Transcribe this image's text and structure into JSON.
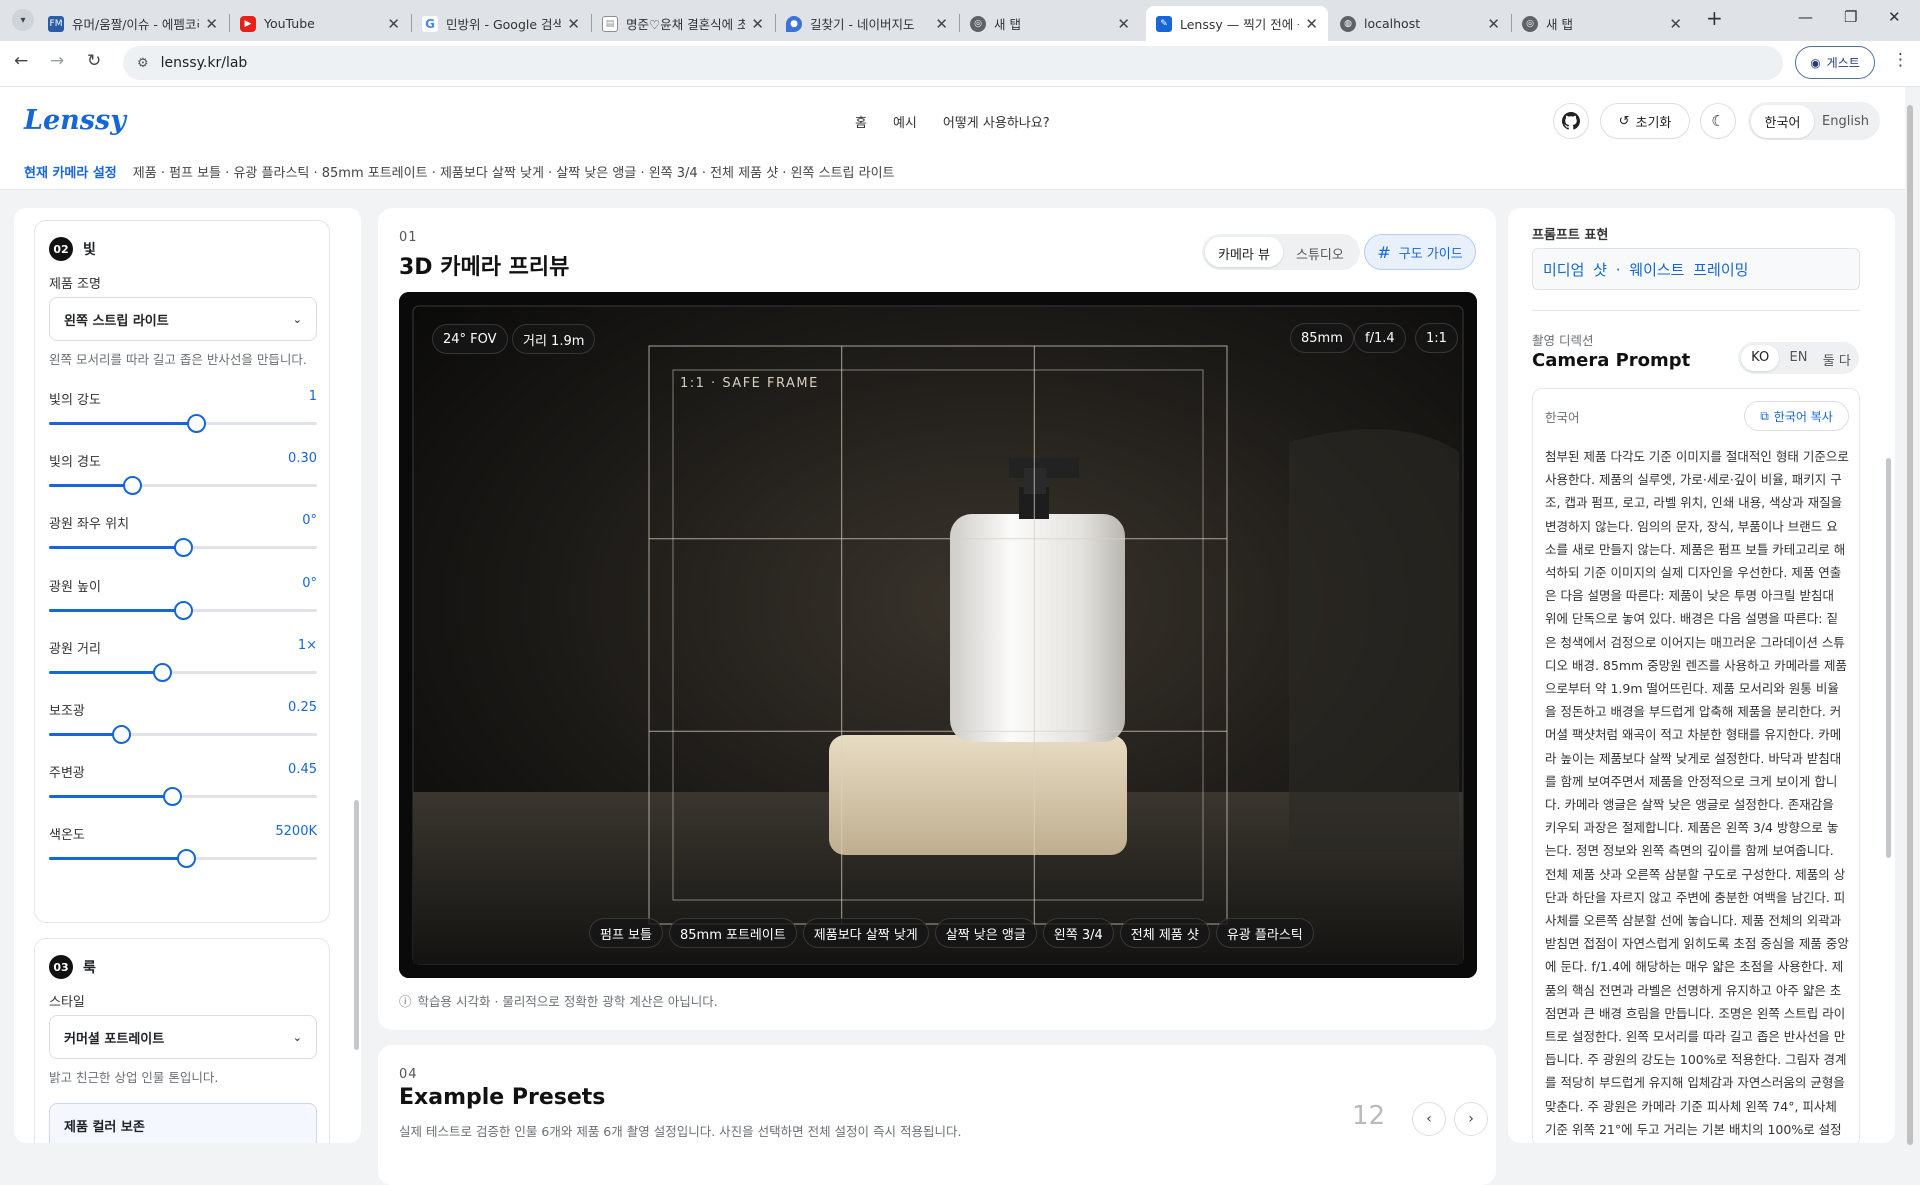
{
  "browser": {
    "tabs": [
      {
        "title": "유머/움짤/이슈 - 에펨코리아",
        "icon": "fmkorea-favicon",
        "color": "#2b5aa7"
      },
      {
        "title": "YouTube",
        "icon": "youtube-favicon",
        "color": "#e62117"
      },
      {
        "title": "민방위 - Google 검색",
        "icon": "google-favicon",
        "color": "#4285f4"
      },
      {
        "title": "명준♡윤채 결혼식에 초대합니다",
        "icon": "document-favicon",
        "color": "#8a8f96"
      },
      {
        "title": "길찾기 - 네이버지도",
        "icon": "map-pin-favicon",
        "color": "#3b73d6"
      },
      {
        "title": "새 탭",
        "icon": "chrome-favicon",
        "color": "#5f6368"
      },
      {
        "title": "Lenssy — 찍기 전에 구도를",
        "icon": "lenssy-favicon",
        "color": "#1566d6"
      },
      {
        "title": "localhost",
        "icon": "globe-favicon",
        "color": "#5f6368"
      },
      {
        "title": "새 탭",
        "icon": "chrome-favicon",
        "color": "#5f6368"
      }
    ],
    "url": "lenssy.kr/lab",
    "guest_label": "게스트"
  },
  "app": {
    "logo": "Lenssy",
    "nav": [
      "홈",
      "예시",
      "어떻게 사용하나요?"
    ],
    "reset_label": "초기화",
    "lang": [
      "한국어",
      "English"
    ]
  },
  "breadcrumb": {
    "label": "현재 카메라 설정",
    "value": "제품 · 펌프 보틀 · 유광 플라스틱 · 85mm 포트레이트 · 제품보다 살짝 낮게 · 살짝 낮은 앵글 · 왼쪽 3/4 · 전체 제품 샷 · 왼쪽 스트립 라이트"
  },
  "light_section": {
    "num": "02",
    "title": "빛",
    "lighting_label": "제품 조명",
    "lighting_value": "왼쪽 스트립 라이트",
    "lighting_hint": "왼쪽 모서리를 따라 길고 좁은 반사선을 만듭니다.",
    "sliders": [
      {
        "label": "빛의 강도",
        "value": "1",
        "level": 0.55
      },
      {
        "label": "빛의 경도",
        "value": "0.30",
        "level": 0.31
      },
      {
        "label": "광원 좌우 위치",
        "value": "0°",
        "level": 0.5
      },
      {
        "label": "광원 높이",
        "value": "0°",
        "level": 0.5
      },
      {
        "label": "광원 거리",
        "value": "1×",
        "level": 0.42
      },
      {
        "label": "보조광",
        "value": "0.25",
        "level": 0.27
      },
      {
        "label": "주변광",
        "value": "0.45",
        "level": 0.46
      },
      {
        "label": "색온도",
        "value": "5200K",
        "level": 0.51
      }
    ]
  },
  "look_section": {
    "num": "03",
    "title": "룩",
    "style_label": "스타일",
    "style_value": "커머셜 포트레이트",
    "style_hint": "밝고 친근한 상업 인물 톤입니다.",
    "color_label": "제품 컬러 보존"
  },
  "preview": {
    "step": "01",
    "title": "3D 카메라 프리뷰",
    "view_tabs": [
      "카메라 뷰",
      "스튜디오"
    ],
    "guide_label": "구도 가이드",
    "fov_chip": "24° FOV",
    "distance_chip": "거리 1.9m",
    "lens_chip": "85mm",
    "aperture_chip": "f/1.4",
    "ratio_chip": "1:1",
    "safe_frame_label": "1:1 · SAFE FRAME",
    "tags": [
      "펌프 보틀",
      "85mm 포트레이트",
      "제품보다 살짝 낮게",
      "살짝 낮은 앵글",
      "왼쪽 3/4",
      "전체 제품 샷",
      "유광 플라스틱"
    ],
    "footnote": "학습용 시각화 · 물리적으로 정확한 광학 계산은 아닙니다."
  },
  "presets": {
    "step": "04",
    "title": "Example Presets",
    "subtitle": "실제 테스트로 검증한 인물 6개와 제품 6개 촬영 설정입니다. 사진을 선택하면 전체 설정이 즉시 적용됩니다.",
    "count": "12"
  },
  "prompt_panel": {
    "expr_label": "프롬프트 표현",
    "expr_value": "미디엄 샷 · 웨이스트 프레이밍",
    "direction_label": "촬영 디렉션",
    "title": "Camera Prompt",
    "lang_tabs": [
      "KO",
      "EN",
      "둘 다"
    ],
    "box_label": "한국어",
    "copy_label": "한국어 복사",
    "text": "첨부된 제품 다각도 기준 이미지를 절대적인 형태 기준으로 사용한다. 제품의 실루엣, 가로·세로·깊이 비율, 패키지 구조, 캡과 펌프, 로고, 라벨 위치, 인쇄 내용, 색상과 재질을 변경하지 않는다. 임의의 문자, 장식, 부품이나 브랜드 요소를 새로 만들지 않는다. 제품은 펌프 보틀 카테고리로 해석하되 기준 이미지의 실제 디자인을 우선한다. 제품 연출은 다음 설명을 따른다: 제품이 낮은 투명 아크릴 받침대 위에 단독으로 놓여 있다. 배경은 다음 설명을 따른다: 짙은 청색에서 검정으로 이어지는 매끄러운 그라데이션 스튜디오 배경. 85mm 중망원 렌즈를 사용하고 카메라를 제품으로부터 약 1.9m 떨어뜨린다. 제품 모서리와 원통 비율을 정돈하고 배경을 부드럽게 압축해 제품을 분리한다. 커머셜 팩샷처럼 왜곡이 적고 차분한 형태를 유지한다. 카메라 높이는 제품보다 살짝 낮게로 설정한다. 바닥과 받침대를 함께 보여주면서 제품을 안정적으로 크게 보이게 합니다. 카메라 앵글은 살짝 낮은 앵글로 설정한다. 존재감을 키우되 과장은 절제합니다. 제품은 왼쪽 3/4 방향으로 놓는다. 정면 정보와 왼쪽 측면의 깊이를 함께 보여줍니다. 전체 제품 샷과 오른쪽 삼분할 구도로 구성한다. 제품의 상단과 하단을 자르지 않고 주변에 충분한 여백을 남긴다. 피사체를 오른쪽 삼분할 선에 놓습니다. 제품 전체의 외곽과 받침면 접점이 자연스럽게 읽히도록 초점 중심을 제품 중앙에 둔다. f/1.4에 해당하는 매우 얇은 초점을 사용한다. 제품의 핵심 전면과 라벨은 선명하게 유지하고 아주 얇은 초점면과 큰 배경 흐림을 만듭니다. 조명은 왼쪽 스트립 라이트로 설정한다. 왼쪽 모서리를 따라 길고 좁은 반사선을 만듭니다. 주 광원의 강도는 100%로 적용한다. 그림자 경계를 적당히 부드럽게 유지해 입체감과 자연스러움의 균형을 맞춘다. 주 광원은 카메라 기준 피사체 왼쪽 74°, 피사체 기준 위쪽 21°에 두고 거리는 기본 배치의 100%로 설정한다. 크고 넓은 확산 광원을 사용"
  }
}
